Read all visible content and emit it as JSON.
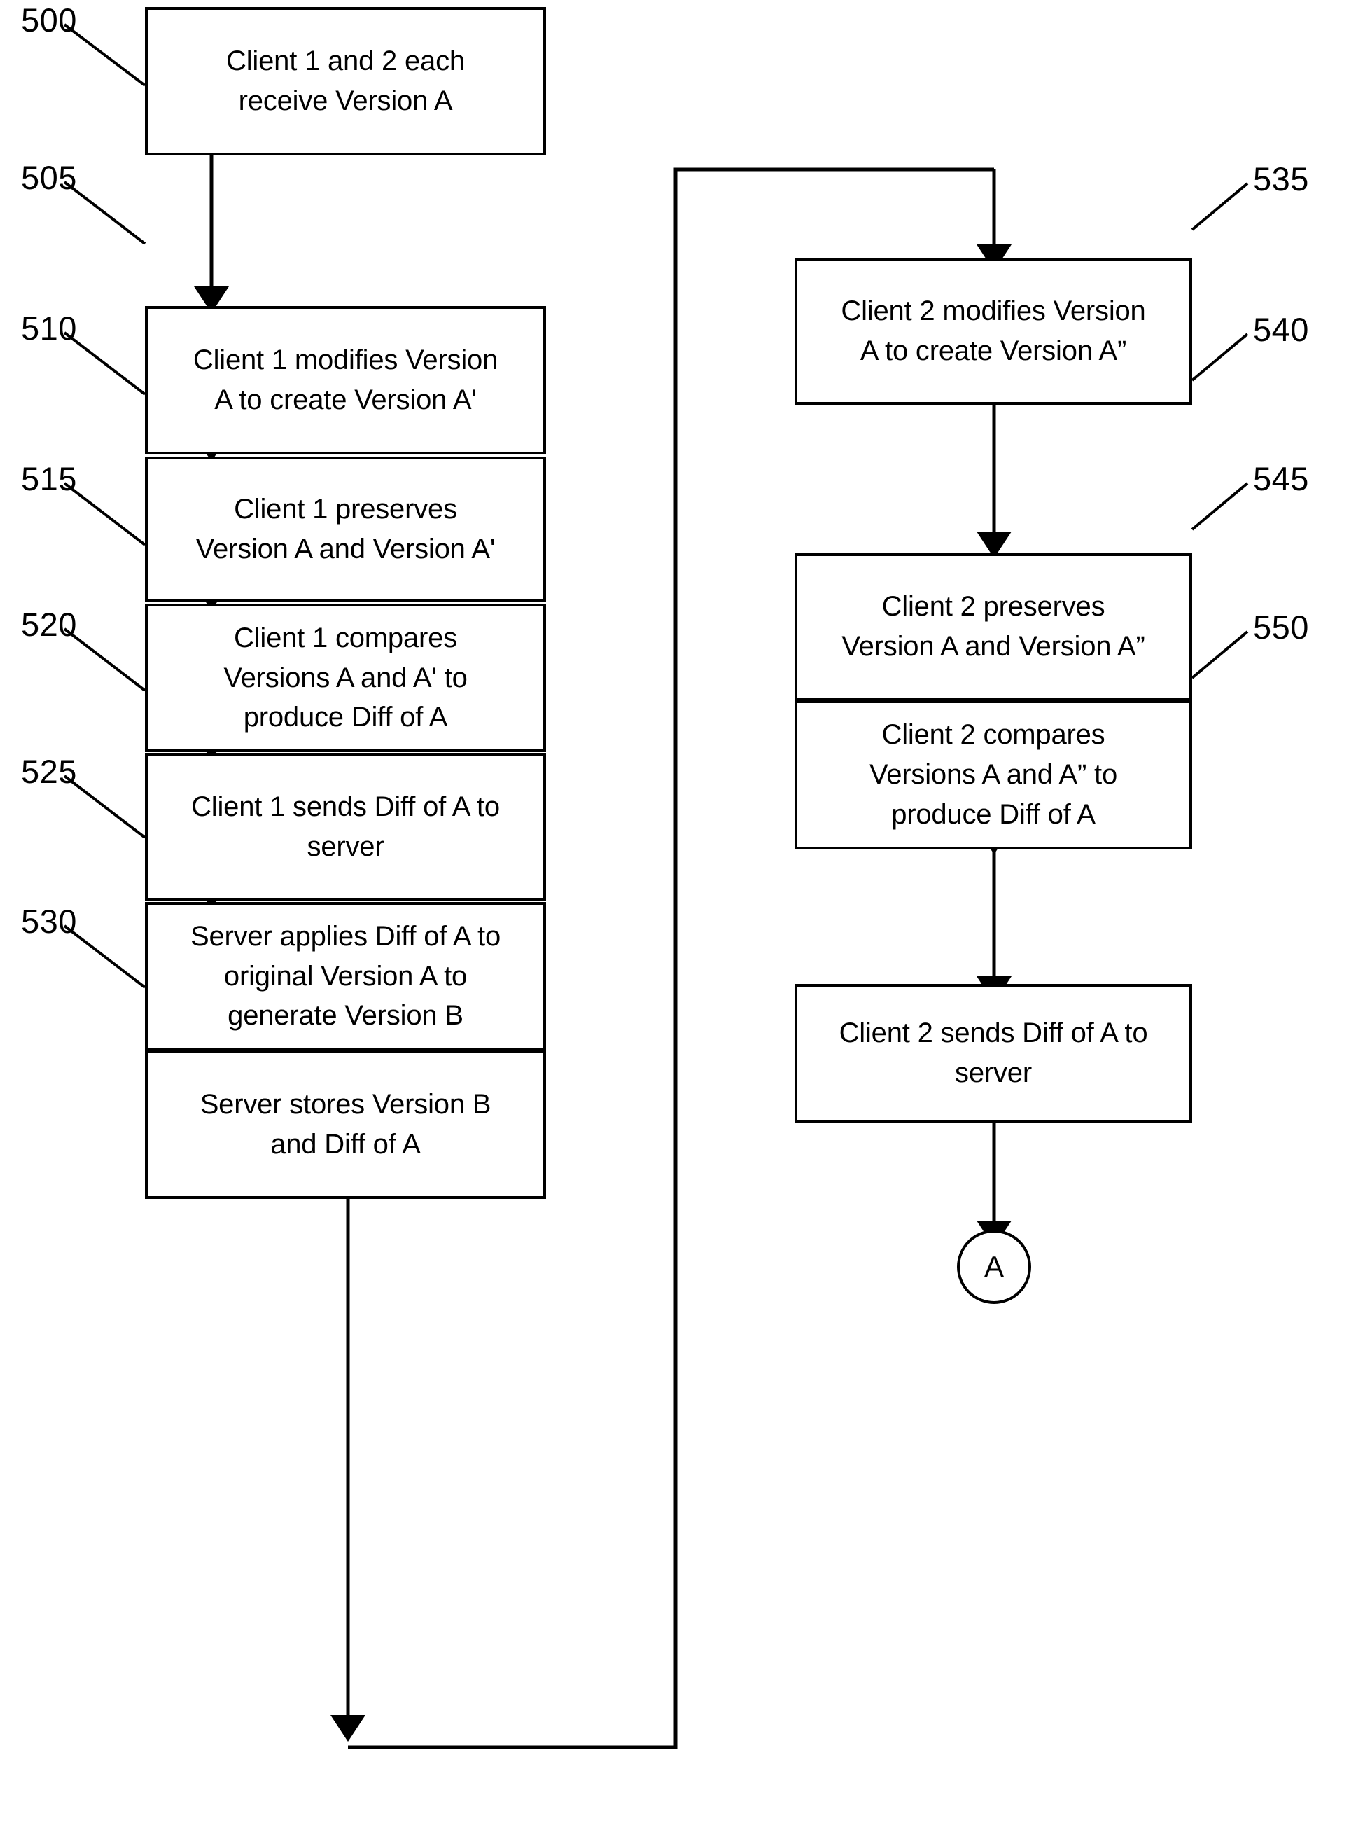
{
  "figure": {
    "type": "patent-flowchart",
    "background_color": "#ffffff",
    "line_color": "#000000"
  },
  "nodes": [
    {
      "ref": "500",
      "text": "Client 1 and 2 each\nreceive Version A",
      "column": "left"
    },
    {
      "ref": "505",
      "text": "Client 1 modifies Version\nA to create Version A'",
      "column": "left"
    },
    {
      "ref": "510",
      "text": "Client 1 preserves\nVersion A and Version A'",
      "column": "left"
    },
    {
      "ref": "515",
      "text": "Client 1 compares\nVersions A and A' to\nproduce Diff of A",
      "column": "left"
    },
    {
      "ref": "520",
      "text": "Client 1 sends Diff of A to\nserver",
      "column": "left"
    },
    {
      "ref": "525",
      "text": "Server applies Diff of A to\noriginal Version A to\ngenerate Version B",
      "column": "left"
    },
    {
      "ref": "530",
      "text": "Server stores Version B\nand Diff of A",
      "column": "left"
    },
    {
      "ref": "535",
      "text": "Client 2 modifies Version\nA to create Version A”",
      "column": "right"
    },
    {
      "ref": "540",
      "text": "Client 2 preserves\nVersion A and Version A”",
      "column": "right"
    },
    {
      "ref": "545",
      "text": "Client 2 compares\nVersions A and A” to\nproduce Diff of A",
      "column": "right"
    },
    {
      "ref": "550",
      "text": "Client 2 sends Diff of A to\nserver",
      "column": "right"
    }
  ],
  "offpage_connector": {
    "label": "A"
  }
}
